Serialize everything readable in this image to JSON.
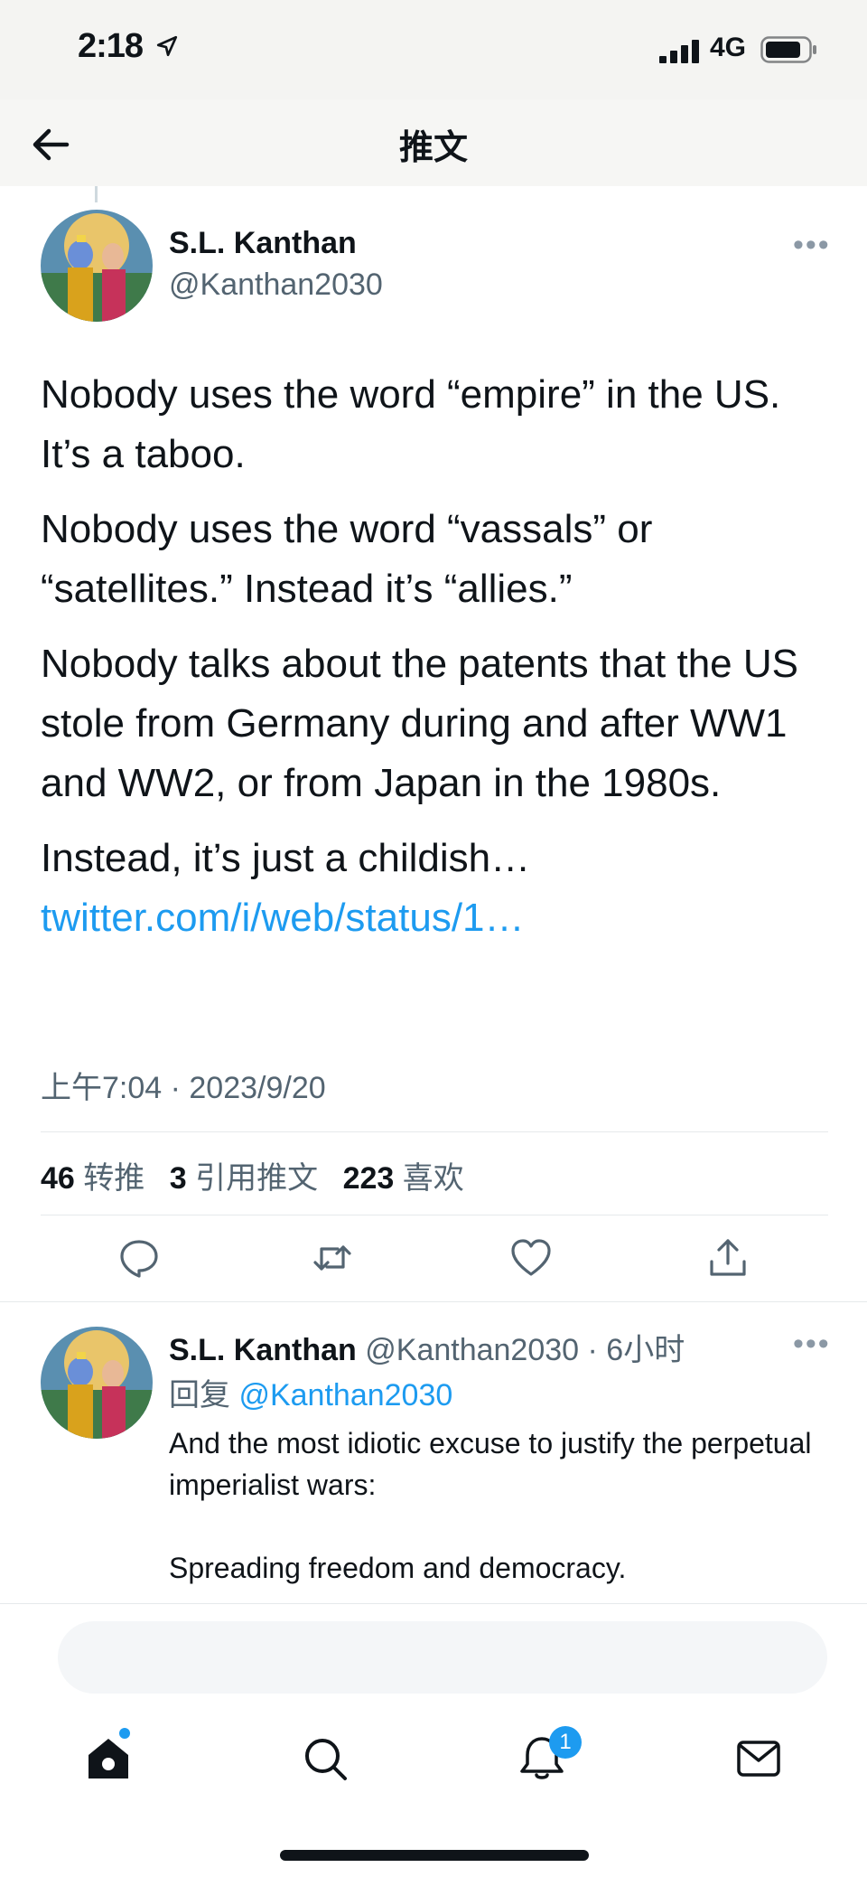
{
  "status": {
    "time": "2:18",
    "network": "4G"
  },
  "nav": {
    "title": "推文"
  },
  "tweet": {
    "author_name": "S.L. Kanthan",
    "author_handle": "@Kanthan2030",
    "paragraphs": [
      "Nobody uses the word “empire” in the US. It’s a taboo.",
      "Nobody uses the word “vassals” or “satellites.” Instead it’s “allies.”",
      "Nobody talks about the patents that the US stole from Germany during and after WW1 and WW2, or from Japan in the 1980s.",
      "Instead, it’s just a childish…"
    ],
    "link": "twitter.com/i/web/status/1…",
    "timestamp": "上午7:04 · 2023/9/20",
    "stats": {
      "retweets_count": "46",
      "retweets_label": "转推",
      "quotes_count": "3",
      "quotes_label": "引用推文",
      "likes_count": "223",
      "likes_label": "喜欢"
    }
  },
  "reply": {
    "author_name": "S.L. Kanthan",
    "meta": "@Kanthan2030 · 6小时",
    "reply_prefix": "回复",
    "reply_to": "@Kanthan2030",
    "line1": "And the most idiotic excuse to justify the perpetual imperialist wars:",
    "line2": "Spreading freedom and democracy."
  },
  "tabbar": {
    "notifications_badge": "1"
  },
  "colors": {
    "accent": "#1d9bf0",
    "text": "#0f1419",
    "secondary": "#536471"
  }
}
